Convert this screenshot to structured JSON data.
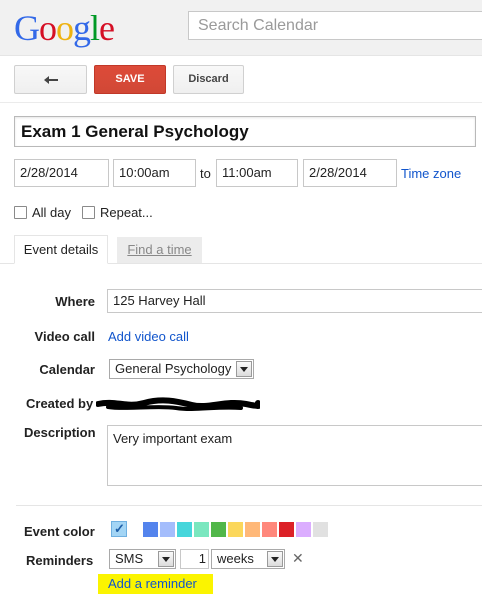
{
  "header": {
    "logo_letters": [
      {
        "ch": "G",
        "color": "#3369e8"
      },
      {
        "ch": "o",
        "color": "#d50f25"
      },
      {
        "ch": "o",
        "color": "#eeb211"
      },
      {
        "ch": "g",
        "color": "#3369e8"
      },
      {
        "ch": "l",
        "color": "#009925"
      },
      {
        "ch": "e",
        "color": "#d50f25"
      }
    ],
    "search_placeholder": "Search Calendar"
  },
  "toolbar": {
    "back_icon": "back-arrow-icon",
    "save_label": "SAVE",
    "discard_label": "Discard"
  },
  "event": {
    "title": "Exam 1 General Psychology",
    "start_date": "2/28/2014",
    "start_time": "10:00am",
    "to_label": "to",
    "end_time": "11:00am",
    "end_date": "2/28/2014",
    "timezone_link": "Time zone",
    "all_day_label": "All day",
    "all_day_checked": false,
    "repeat_label": "Repeat...",
    "repeat_checked": false
  },
  "tabs": {
    "details": "Event details",
    "find_time": "Find a time"
  },
  "details": {
    "where_label": "Where",
    "where_value": "125 Harvey Hall",
    "video_label": "Video call",
    "video_link": "Add video call",
    "calendar_label": "Calendar",
    "calendar_value": "General Psychology",
    "created_by_label": "Created by",
    "description_label": "Description",
    "description_value": "Very important exam"
  },
  "event_color": {
    "label": "Event color",
    "selected_icon": "checkmark-icon",
    "swatches": [
      "#a4bdfc",
      "#5484ed",
      "#a4bdfc",
      "#46d6db",
      "#7ae7bf",
      "#51b749",
      "#fbd75b",
      "#ffb878",
      "#ff887c",
      "#dc2127",
      "#dbadff",
      "#e1e1e1"
    ]
  },
  "reminders": {
    "label": "Reminders",
    "method": "SMS",
    "amount": "1",
    "unit": "weeks",
    "remove_icon": "close-icon",
    "add_link": "Add a reminder"
  }
}
